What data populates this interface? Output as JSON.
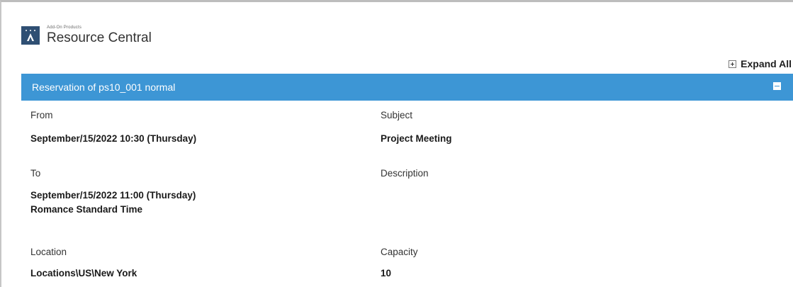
{
  "brand": {
    "small_text": "Add-On Products",
    "title": "Resource Central"
  },
  "toolbar": {
    "expand_all_label": "Expand All"
  },
  "reservation": {
    "header": "Reservation of ps10_001 normal",
    "from_label": "From",
    "from_value": "September/15/2022 10:30 (Thursday)",
    "to_label": "To",
    "to_value": "September/15/2022 11:00 (Thursday)",
    "timezone": "Romance Standard Time",
    "location_label": "Location",
    "location_value": "Locations\\US\\New York",
    "subject_label": "Subject",
    "subject_value": "Project Meeting",
    "description_label": "Description",
    "capacity_label": "Capacity",
    "capacity_value": "10"
  },
  "colors": {
    "header_bar": "#3d96d5",
    "logo_bg": "#2f4f73"
  }
}
